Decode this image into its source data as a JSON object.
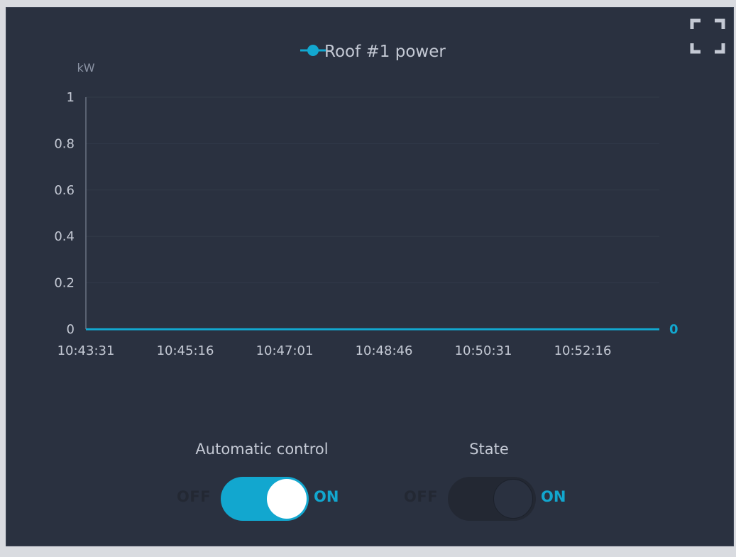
{
  "colors": {
    "accent": "#12a7cf",
    "panel_bg": "#2a3140",
    "axis_text": "#c4c9d4",
    "grid": "#323a49",
    "toggle_off_track": "#232833"
  },
  "header": {
    "fullscreen_icon": "fullscreen-icon"
  },
  "chart_data": {
    "type": "line",
    "title": "",
    "ylabel": "kW",
    "xlabel": "",
    "ylim": [
      0,
      1
    ],
    "yticks": [
      "0",
      "0.2",
      "0.4",
      "0.6",
      "0.8",
      "1"
    ],
    "xticks": [
      "10:43:31",
      "10:45:16",
      "10:47:01",
      "10:48:46",
      "10:50:31",
      "10:52:16"
    ],
    "grid": true,
    "legend": "top-center",
    "series": [
      {
        "name": "Roof #1 power",
        "color": "#12a7cf",
        "x": [
          "10:43:31",
          "10:45:16",
          "10:47:01",
          "10:48:46",
          "10:50:31",
          "10:52:16",
          "10:54:01"
        ],
        "y": [
          0,
          0,
          0,
          0,
          0,
          0,
          0
        ],
        "last_value_label": "0"
      }
    ]
  },
  "controls": {
    "automatic_control": {
      "label": "Automatic control",
      "off_label": "OFF",
      "on_label": "ON",
      "state": "on"
    },
    "state": {
      "label": "State",
      "off_label": "OFF",
      "on_label": "ON",
      "state": "off"
    }
  }
}
